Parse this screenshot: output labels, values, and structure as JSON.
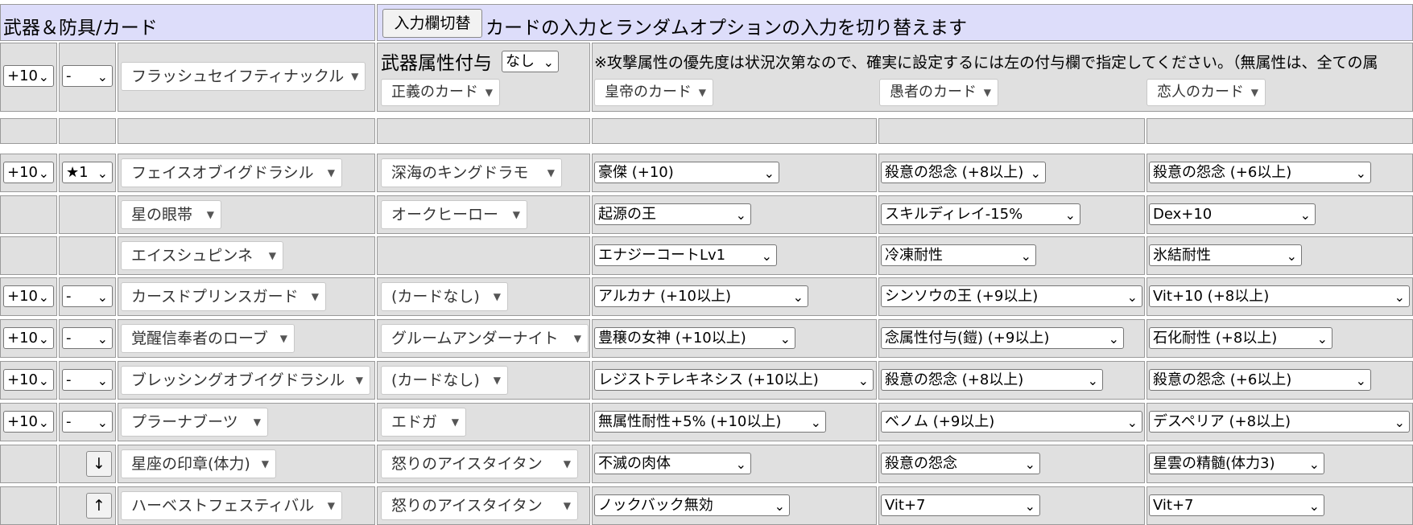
{
  "header": {
    "section_title": "武器＆防具/カード",
    "toggle_button": "入力欄切替",
    "toggle_description": "カードの入力とランダムオプションの入力を切り替えます"
  },
  "weapon": {
    "refine": "+10",
    "grade": "-",
    "name": "フラッシュセイフティナックル",
    "element_label": "武器属性付与",
    "element_value": "なし",
    "note": "※攻撃属性の優先度は状況次第なので、確実に設定するには左の付与欄で指定してください。（無属性は、全ての属",
    "cards": [
      "正義のカード",
      "皇帝のカード",
      "愚者のカード",
      "恋人のカード"
    ]
  },
  "equipment": [
    {
      "refine": "+10",
      "grade": "★1",
      "name": "フェイスオブイグドラシル",
      "card": "深海のキングドラモ",
      "opts": [
        "豪傑 (+10)",
        "殺意の怨念 (+8以上)",
        "殺意の怨念 (+6以上)"
      ]
    },
    {
      "refine": "",
      "grade": "",
      "name": "星の眼帯",
      "card": "オークヒーロー",
      "opts": [
        "起源の王",
        "スキルディレイ-15%",
        "Dex+10"
      ]
    },
    {
      "refine": "",
      "grade": "",
      "name": "エイスシュピンネ",
      "card": "",
      "opts": [
        "エナジーコートLv1",
        "冷凍耐性",
        "氷結耐性"
      ]
    },
    {
      "refine": "+10",
      "grade": "-",
      "name": "カースドプリンスガード",
      "card": "(カードなし)",
      "opts": [
        "アルカナ (+10以上)",
        "シンソウの王 (+9以上)",
        "Vit+10 (+8以上)"
      ]
    },
    {
      "refine": "+10",
      "grade": "-",
      "name": "覚醒信奉者のローブ",
      "card": "グルームアンダーナイト",
      "opts": [
        "豊穣の女神 (+10以上)",
        "念属性付与(鎧) (+9以上)",
        "石化耐性 (+8以上)"
      ]
    },
    {
      "refine": "+10",
      "grade": "-",
      "name": "ブレッシングオブイグドラシル",
      "card": "(カードなし)",
      "opts": [
        "レジストテレキネシス (+10以上)",
        "殺意の怨念 (+8以上)",
        "殺意の怨念 (+6以上)"
      ]
    },
    {
      "refine": "+10",
      "grade": "-",
      "name": "プラーナブーツ",
      "card": "エドガ",
      "opts": [
        "無属性耐性+5% (+10以上)",
        "ベノム (+9以上)",
        "デスペリア (+8以上)"
      ]
    },
    {
      "refine": "",
      "grade": "",
      "arrow": "↓",
      "name": "星座の印章(体力)",
      "card": "怒りのアイスタイタン",
      "opts": [
        "不滅の肉体",
        "殺意の怨念",
        "星雲の精髄(体力3)"
      ]
    },
    {
      "refine": "",
      "grade": "",
      "arrow": "↑",
      "name": "ハーベストフェスティバル",
      "card": "怒りのアイスタイタン",
      "opts": [
        "ノックバック無効",
        "Vit+7",
        "Vit+7"
      ]
    }
  ]
}
